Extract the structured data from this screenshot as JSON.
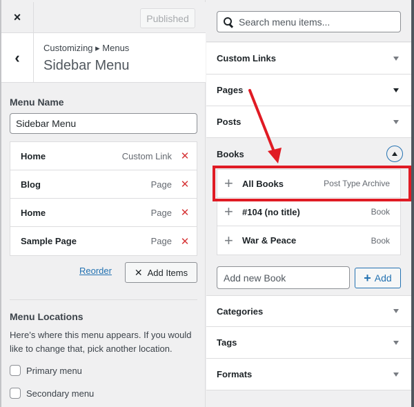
{
  "header": {
    "close_icon": "×",
    "published_label": "Published",
    "back_icon": "‹",
    "breadcrumb": "Customizing ▸ Menus",
    "title": "Sidebar Menu"
  },
  "menu_name": {
    "label": "Menu Name",
    "value": "Sidebar Menu"
  },
  "menu_items": [
    {
      "title": "Home",
      "type": "Custom Link",
      "delete_icon": "✕"
    },
    {
      "title": "Blog",
      "type": "Page",
      "delete_icon": "✕"
    },
    {
      "title": "Home",
      "type": "Page",
      "delete_icon": "✕"
    },
    {
      "title": "Sample Page",
      "type": "Page",
      "delete_icon": "✕"
    }
  ],
  "actions": {
    "reorder_label": "Reorder",
    "add_items_icon": "✕",
    "add_items_label": "Add Items"
  },
  "menu_locations": {
    "heading": "Menu Locations",
    "description": "Here’s where this menu appears. If you would like to change that, pick another location.",
    "options": [
      {
        "label": "Primary menu",
        "checked": false
      },
      {
        "label": "Secondary menu",
        "checked": false
      }
    ]
  },
  "search": {
    "placeholder": "Search menu items..."
  },
  "accordions": [
    {
      "title": "Custom Links",
      "state": "collapsed"
    },
    {
      "title": "Pages",
      "state": "collapsed"
    },
    {
      "title": "Posts",
      "state": "collapsed"
    },
    {
      "title": "Books",
      "state": "expanded"
    },
    {
      "title": "Categories",
      "state": "collapsed"
    },
    {
      "title": "Tags",
      "state": "collapsed"
    },
    {
      "title": "Formats",
      "state": "collapsed"
    }
  ],
  "books": {
    "items": [
      {
        "title": "All Books",
        "type": "Post Type Archive",
        "plus_icon": "+"
      },
      {
        "title": "#104 (no title)",
        "type": "Book",
        "plus_icon": "+"
      },
      {
        "title": "War & Peace",
        "type": "Book",
        "plus_icon": "+"
      }
    ],
    "new_placeholder": "Add new Book",
    "add_icon": "+",
    "add_label": "Add"
  },
  "annotation": {
    "color": "#e01b24",
    "highlighted_item": "All Books"
  }
}
